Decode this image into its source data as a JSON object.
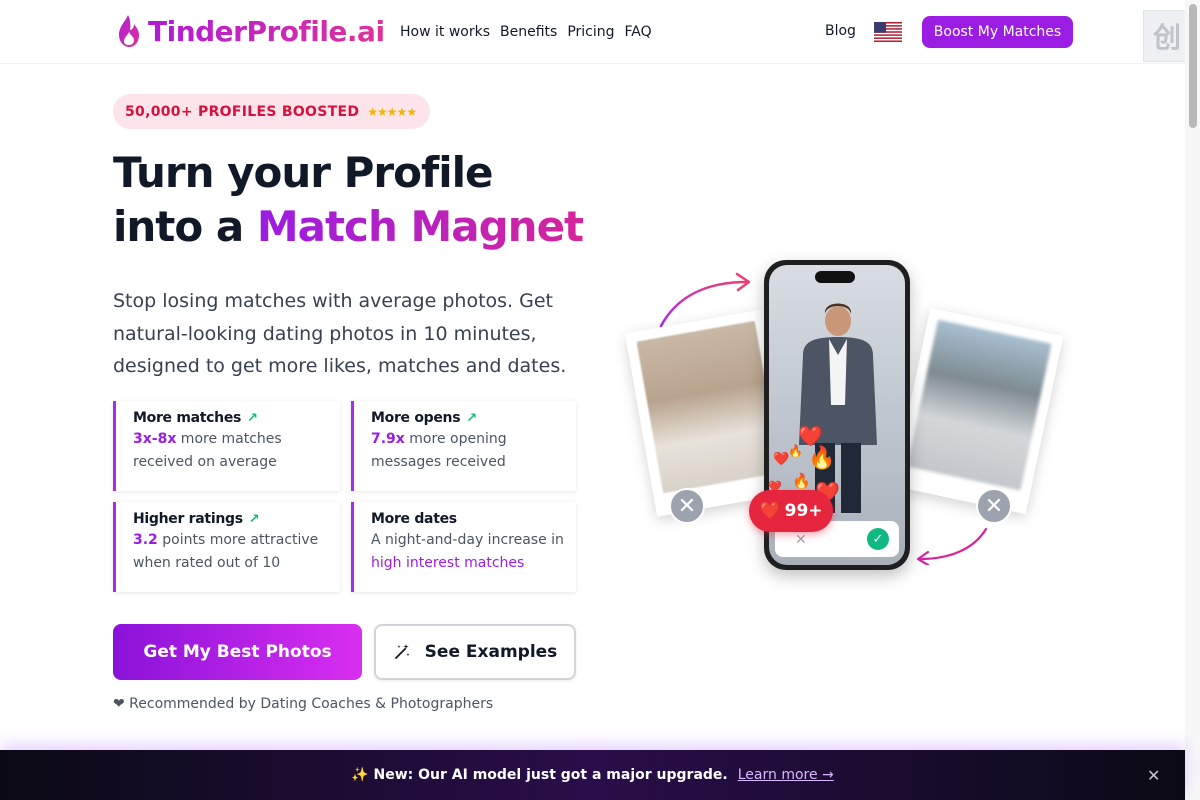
{
  "nav": {
    "brand": "TinderProfile.ai",
    "links": [
      "How it works",
      "Benefits",
      "Pricing",
      "FAQ"
    ],
    "blog": "Blog",
    "cta": "Boost My Matches"
  },
  "hero": {
    "badge": "50,000+ PROFILES BOOSTED",
    "stars": "★★★★★",
    "title_line1": "Turn your Profile",
    "title_line2_prefix": "into a ",
    "title_line2_accent": "Match Magnet",
    "subtitle": "Stop losing matches with average photos. Get natural-looking dating photos in 10 minutes, designed to get more likes, matches and dates."
  },
  "stats": [
    {
      "title": "More matches",
      "highlight": "3x-8x",
      "text": " more matches received on average"
    },
    {
      "title": "More opens",
      "highlight": "7.9x",
      "text": " more opening messages received"
    },
    {
      "title": "Higher ratings",
      "highlight": "3.2",
      "text": " points more attractive when rated out of 10"
    },
    {
      "title": "More dates",
      "text": "A night-and-day increase in ",
      "link": "high interest matches"
    }
  ],
  "cta": {
    "primary": "Get My Best Photos",
    "secondary": "See Examples",
    "recommended": "❤ Recommended by Dating Coaches & Photographers"
  },
  "visual": {
    "match_count": "99+"
  },
  "banner": {
    "text": "✨ New: Our AI model just got a major upgrade.",
    "link": "Learn more →"
  },
  "colors": {
    "brand_purple": "#9b1de3",
    "accent_pink": "#d6259b",
    "badge_red": "#d4123f",
    "success_green": "#10b981"
  },
  "icons": [
    "flame-logo-icon",
    "us-flag-icon",
    "trend-up-icon",
    "magic-wand-icon",
    "close-icon",
    "check-icon",
    "heart-icon",
    "fire-icon"
  ]
}
